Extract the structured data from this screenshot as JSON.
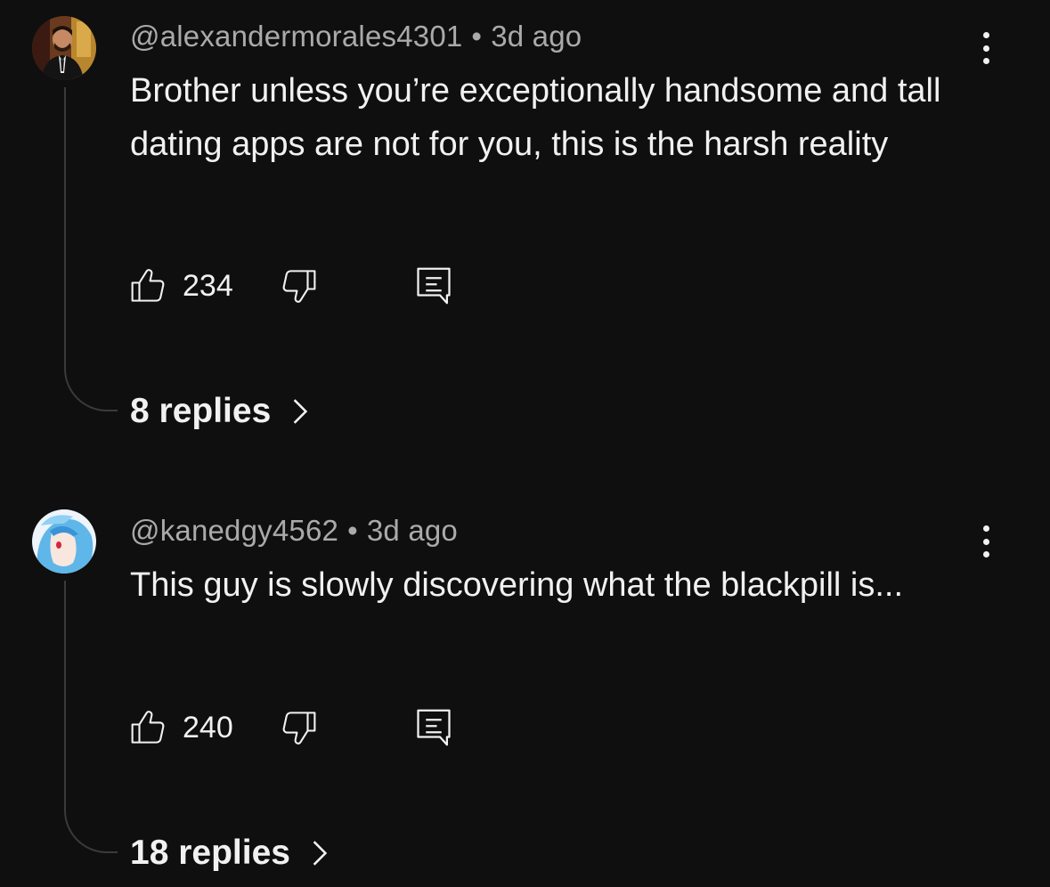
{
  "comments": [
    {
      "username": "@alexandermorales4301",
      "time": "3d ago",
      "text": "Brother unless you’re exceptionally handsome and tall dating apps are not for you, this is the harsh reality",
      "likes": "234",
      "replies": "8 replies",
      "avatar_icon": "user-avatar-photo"
    },
    {
      "username": "@kanedgy4562",
      "time": "3d ago",
      "text": "This guy is slowly discovering what the blackpill is...",
      "likes": "240",
      "replies": "18 replies",
      "avatar_icon": "anime-avatar"
    }
  ],
  "separator": "•",
  "icons": {
    "like": "thumbs-up-icon",
    "dislike": "thumbs-down-icon",
    "reply": "comment-icon",
    "menu": "more-vert-icon",
    "chevron": "chevron-right-icon"
  },
  "colors": {
    "background": "#0f0f0f",
    "primary_text": "#f1f1f1",
    "secondary_text": "#aaaaaa",
    "thread_line": "#3a3a3a"
  }
}
